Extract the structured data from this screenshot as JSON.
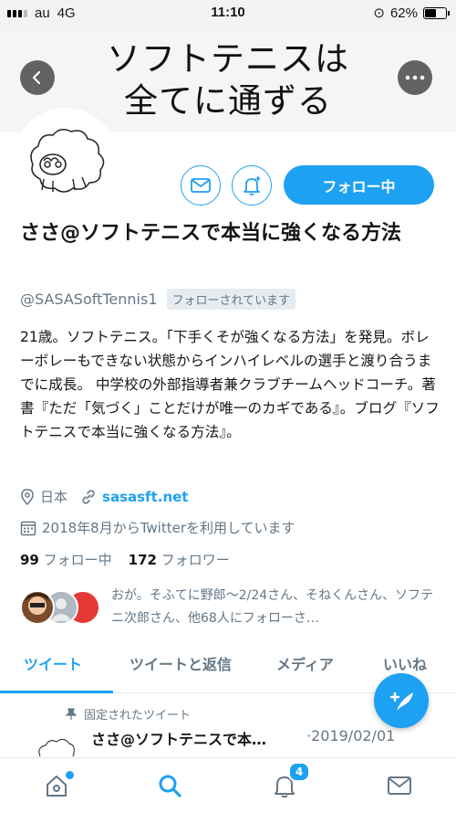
{
  "status_bar": {
    "carrier": "au",
    "network": "4G",
    "time": "11:10",
    "battery": "62%",
    "battery_level": 0.62
  },
  "banner": {
    "line1": "ソフトテニスは",
    "line2": "全てに通ずる"
  },
  "profile": {
    "name": "ささ@ソフトテニスで本当に強くなる方法",
    "handle": "@SASASoftTennis1",
    "follows_you": "フォローされています",
    "follow_button": "フォロー中",
    "bio": "21歳。ソフトテニス。「下手くそが強くなる方法」を発見。ボレーボレーもできない状態からインハイレベルの選手と渡り合うまでに成長。 中学校の外部指導者兼クラブチームヘッドコーチ。著書『ただ「気づく」ことだけが唯一のカギである』。ブログ『ソフトテニスで本当に強くなる方法』。",
    "location": "日本",
    "website": "sasasft.net",
    "joined": "2018年8月からTwitterを利用しています",
    "following_count": "99",
    "following_label": "フォロー中",
    "followers_count": "172",
    "followers_label": "フォロワー",
    "followed_by": "おが。そふてに野郎〜2/24さん、そねくんさん、ソフテニ次郎さん、他68人にフォローさ…"
  },
  "tabs": [
    {
      "label": "ツイート",
      "active": true
    },
    {
      "label": "ツイートと返信",
      "active": false
    },
    {
      "label": "メディア",
      "active": false
    },
    {
      "label": "いいね",
      "active": false
    }
  ],
  "pinned": {
    "label": "固定されたツイート",
    "author": "ささ@ソフトテニスで本…",
    "date": "·2019/02/01"
  },
  "bottom_nav": {
    "notifications_badge": "4",
    "items": [
      "home-icon",
      "search-icon",
      "notifications-icon",
      "messages-icon"
    ]
  },
  "colors": {
    "accent": "#1da1f2",
    "secondary_text": "#657786"
  }
}
